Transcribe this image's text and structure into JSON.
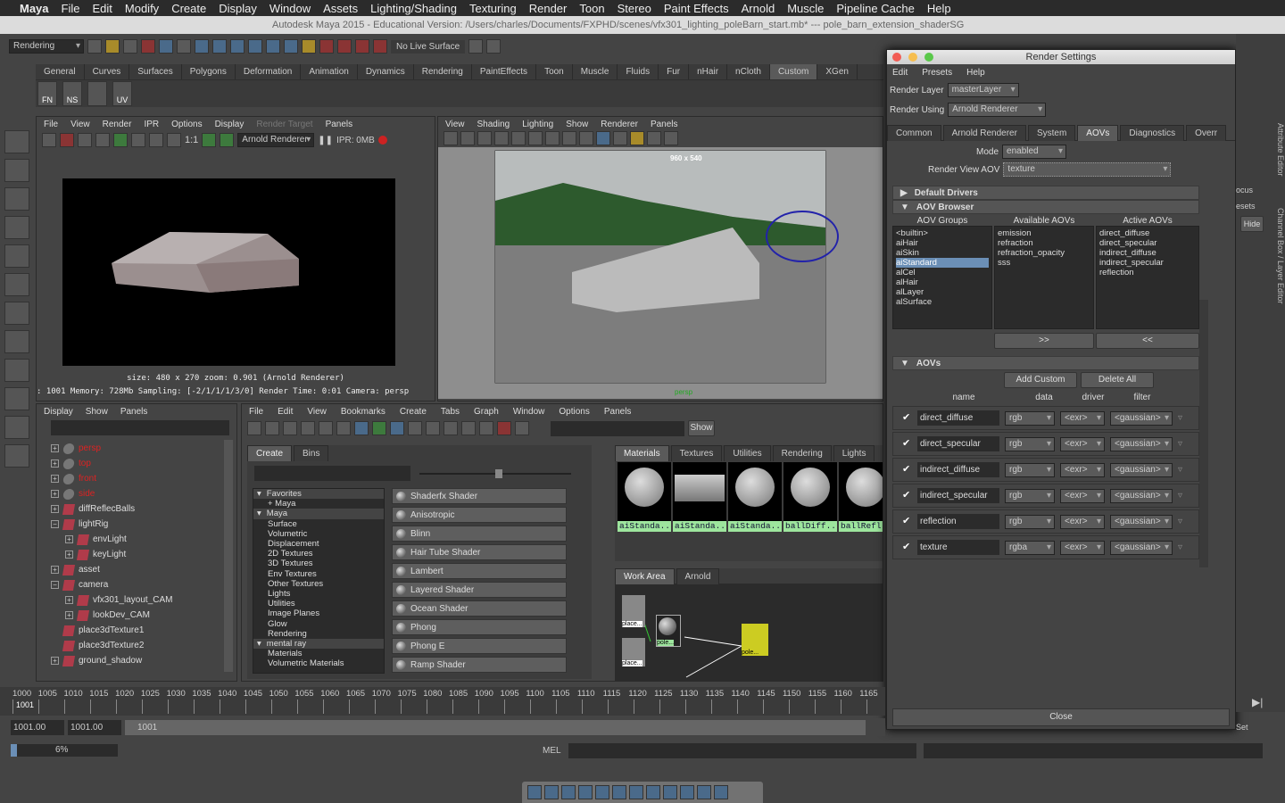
{
  "mac_menu": [
    "Maya",
    "File",
    "Edit",
    "Modify",
    "Create",
    "Display",
    "Window",
    "Assets",
    "Lighting/Shading",
    "Texturing",
    "Render",
    "Toon",
    "Stereo",
    "Paint Effects",
    "Arnold",
    "Muscle",
    "Pipeline Cache",
    "Help"
  ],
  "window_title": "Autodesk Maya 2015 - Educational Version: /Users/charles/Documents/FXPHD/scenes/vfx301_lighting_poleBarn_start.mb*  ---  pole_barn_extension_shaderSG",
  "status": {
    "menu_set": "Rendering",
    "live_surface": "No Live Surface"
  },
  "shelf_tabs": [
    "General",
    "Curves",
    "Surfaces",
    "Polygons",
    "Deformation",
    "Animation",
    "Dynamics",
    "Rendering",
    "PaintEffects",
    "Toon",
    "Muscle",
    "Fluids",
    "Fur",
    "nHair",
    "nCloth",
    "Custom",
    "XGen"
  ],
  "shelf_active": "Custom",
  "shelf_buttons": [
    "FN",
    "NS",
    "",
    "UV"
  ],
  "render_view": {
    "menu": [
      "File",
      "View",
      "Render",
      "IPR",
      "Options",
      "Display",
      "Render Target",
      "Panels"
    ],
    "renderer": "Arnold Renderer",
    "ipr": "IPR: 0MB",
    "ratio": "1:1",
    "info1": "size: 480 x 270 zoom: 0.901    (Arnold Renderer)",
    "info2": ": 1001   Memory: 728Mb   Sampling: [-2/1/1/1/3/0]   Render Time: 0:01   Camera: persp"
  },
  "viewport": {
    "menu": [
      "View",
      "Shading",
      "Lighting",
      "Show",
      "Renderer",
      "Panels"
    ],
    "resolution": "960 x 540",
    "camera": "persp"
  },
  "outliner": {
    "menu": [
      "Display",
      "Show",
      "Panels"
    ],
    "items": [
      {
        "label": "persp",
        "depth": 0,
        "red": true,
        "exp": "+"
      },
      {
        "label": "top",
        "depth": 0,
        "red": true,
        "exp": "+"
      },
      {
        "label": "front",
        "depth": 0,
        "red": true,
        "exp": "+"
      },
      {
        "label": "side",
        "depth": 0,
        "red": true,
        "exp": "+"
      },
      {
        "label": "diffReflecBalls",
        "depth": 0,
        "exp": "+"
      },
      {
        "label": "lightRig",
        "depth": 0,
        "exp": "-"
      },
      {
        "label": "envLight",
        "depth": 1,
        "exp": "+"
      },
      {
        "label": "keyLight",
        "depth": 1,
        "exp": "+"
      },
      {
        "label": "asset",
        "depth": 0,
        "exp": "+"
      },
      {
        "label": "camera",
        "depth": 0,
        "exp": "-"
      },
      {
        "label": "vfx301_layout_CAM",
        "depth": 1,
        "exp": "+"
      },
      {
        "label": "lookDev_CAM",
        "depth": 1,
        "exp": "+"
      },
      {
        "label": "place3dTexture1",
        "depth": 0,
        "exp": ""
      },
      {
        "label": "place3dTexture2",
        "depth": 0,
        "exp": ""
      },
      {
        "label": "ground_shadow",
        "depth": 0,
        "exp": "+"
      }
    ]
  },
  "hypershade": {
    "menu": [
      "File",
      "Edit",
      "View",
      "Bookmarks",
      "Create",
      "Tabs",
      "Graph",
      "Window",
      "Options",
      "Panels"
    ],
    "show": "Show",
    "create_tabs": [
      "Create",
      "Bins"
    ],
    "categories": [
      {
        "label": "Favorites",
        "hdr": true
      },
      {
        "label": "+ Maya",
        "hdr": false
      },
      {
        "label": "Maya",
        "hdr": true
      },
      {
        "label": "Surface"
      },
      {
        "label": "Volumetric"
      },
      {
        "label": "Displacement"
      },
      {
        "label": "2D Textures"
      },
      {
        "label": "3D Textures"
      },
      {
        "label": "Env Textures"
      },
      {
        "label": "Other Textures"
      },
      {
        "label": "Lights"
      },
      {
        "label": "Utilities"
      },
      {
        "label": "Image Planes"
      },
      {
        "label": "Glow"
      },
      {
        "label": "Rendering"
      },
      {
        "label": "mental ray",
        "hdr": true
      },
      {
        "label": "Materials"
      },
      {
        "label": "Volumetric Materials"
      }
    ],
    "shaders": [
      "Shaderfx Shader",
      "Anisotropic",
      "Blinn",
      "Hair Tube Shader",
      "Lambert",
      "Layered Shader",
      "Ocean Shader",
      "Phong",
      "Phong E",
      "Ramp Shader"
    ],
    "bin_tabs": [
      "Materials",
      "Textures",
      "Utilities",
      "Rendering",
      "Lights"
    ],
    "swatches": [
      "aiStanda...",
      "aiStanda...",
      "aiStanda...",
      "ballDiff...",
      "ballRefl"
    ],
    "work_tabs": [
      "Work Area",
      "Arnold"
    ],
    "nodes": [
      "place...",
      "pole...",
      "place...",
      "pole..."
    ]
  },
  "render_settings": {
    "title": "Render Settings",
    "menu": [
      "Edit",
      "Presets",
      "Help"
    ],
    "render_layer_label": "Render Layer",
    "render_layer": "masterLayer",
    "render_using_label": "Render Using",
    "render_using": "Arnold Renderer",
    "tabs": [
      "Common",
      "Arnold Renderer",
      "System",
      "AOVs",
      "Diagnostics",
      "Overr"
    ],
    "active_tab": "AOVs",
    "mode_label": "Mode",
    "mode": "enabled",
    "rv_aov_label": "Render View AOV",
    "rv_aov": "texture",
    "sections": {
      "default_drivers": "Default Drivers",
      "aov_browser": "AOV Browser",
      "aovs": "AOVs"
    },
    "browser": {
      "groups_label": "AOV Groups",
      "available_label": "Available AOVs",
      "active_label": "Active AOVs",
      "groups": [
        "<builtin>",
        "aiHair",
        "aiSkin",
        "aiStandard",
        "alCel",
        "alHair",
        "alLayer",
        "alSurface"
      ],
      "selected_group": "aiStandard",
      "available": [
        "emission",
        "refraction",
        "refraction_opacity",
        "sss"
      ],
      "active": [
        "direct_diffuse",
        "direct_specular",
        "indirect_diffuse",
        "indirect_specular",
        "reflection"
      ],
      "add": ">>",
      "remove": "<<"
    },
    "add_custom": "Add Custom",
    "delete_all": "Delete All",
    "columns": [
      "name",
      "data",
      "driver",
      "filter"
    ],
    "aovs": [
      {
        "name": "direct_diffuse",
        "data": "rgb",
        "driver": "<exr>",
        "filter": "<gaussian>",
        "enabled": true
      },
      {
        "name": "direct_specular",
        "data": "rgb",
        "driver": "<exr>",
        "filter": "<gaussian>",
        "enabled": true
      },
      {
        "name": "indirect_diffuse",
        "data": "rgb",
        "driver": "<exr>",
        "filter": "<gaussian>",
        "enabled": true
      },
      {
        "name": "indirect_specular",
        "data": "rgb",
        "driver": "<exr>",
        "filter": "<gaussian>",
        "enabled": true
      },
      {
        "name": "reflection",
        "data": "rgb",
        "driver": "<exr>",
        "filter": "<gaussian>",
        "enabled": true
      },
      {
        "name": "texture",
        "data": "rgba",
        "driver": "<exr>",
        "filter": "<gaussian>",
        "enabled": true
      }
    ],
    "close": "Close"
  },
  "right_strip": {
    "tabs": [
      "Attribute Editor",
      "Channel Box / Layer Editor"
    ],
    "labels": [
      "ocus",
      "esets",
      "Hide",
      "Set"
    ]
  },
  "timeline": {
    "ticks": [
      "1000",
      "1005",
      "1010",
      "1015",
      "1020",
      "1025",
      "1030",
      "1035",
      "1040",
      "1045",
      "1050",
      "1055",
      "1060",
      "1065",
      "1070",
      "1075",
      "1080",
      "1085",
      "1090",
      "1095",
      "1100",
      "1105",
      "1110",
      "1115",
      "1120",
      "1125",
      "1130",
      "1135",
      "1140",
      "1145",
      "1150",
      "1155",
      "1160",
      "1165"
    ],
    "current": "1001"
  },
  "range": {
    "start": "1001.00",
    "start2": "1001.00",
    "field": "1001"
  },
  "command": {
    "progress_label": "6%",
    "progress": 6,
    "lang": "MEL"
  }
}
